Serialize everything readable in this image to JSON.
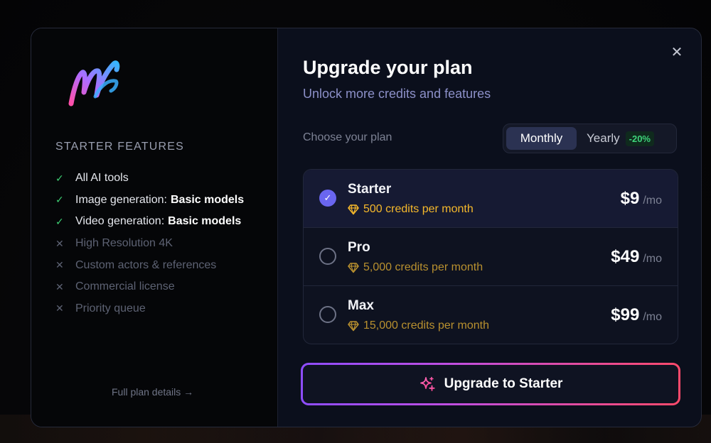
{
  "left_panel": {
    "features_title": "STARTER FEATURES",
    "features": [
      {
        "label": "All AI tools",
        "bold": "",
        "included": true
      },
      {
        "label": "Image generation:",
        "bold": "Basic models",
        "included": true
      },
      {
        "label": "Video generation:",
        "bold": "Basic models",
        "included": true
      },
      {
        "label": "High Resolution 4K",
        "bold": "",
        "included": false
      },
      {
        "label": "Custom actors & references",
        "bold": "",
        "included": false
      },
      {
        "label": "Commercial license",
        "bold": "",
        "included": false
      },
      {
        "label": "Priority queue",
        "bold": "",
        "included": false
      }
    ],
    "check_icon": "✓",
    "cross_icon": "✕",
    "full_details_link": "Full plan details →"
  },
  "header": {
    "title": "Upgrade your plan",
    "subtitle": "Unlock more credits and features"
  },
  "billing": {
    "choose_label": "Choose your plan",
    "monthly_label": "Monthly",
    "yearly_label": "Yearly",
    "discount_badge": "-20%",
    "selected": "Monthly"
  },
  "plans": [
    {
      "name": "Starter",
      "credits": "500 credits per month",
      "price": "$9",
      "per": "/mo",
      "selected": true
    },
    {
      "name": "Pro",
      "credits": "5,000 credits per month",
      "price": "$49",
      "per": "/mo",
      "selected": false
    },
    {
      "name": "Max",
      "credits": "15,000 credits per month",
      "price": "$99",
      "per": "/mo",
      "selected": false
    }
  ],
  "cta": {
    "label": "Upgrade to Starter"
  },
  "close_icon": "✕",
  "colors": {
    "accent": "#6a66f0",
    "check_green": "#3ecf73",
    "credits_gold": "#f5b82b",
    "cta_gradient_start": "#8e4dff",
    "cta_gradient_end": "#ff4a6b"
  }
}
